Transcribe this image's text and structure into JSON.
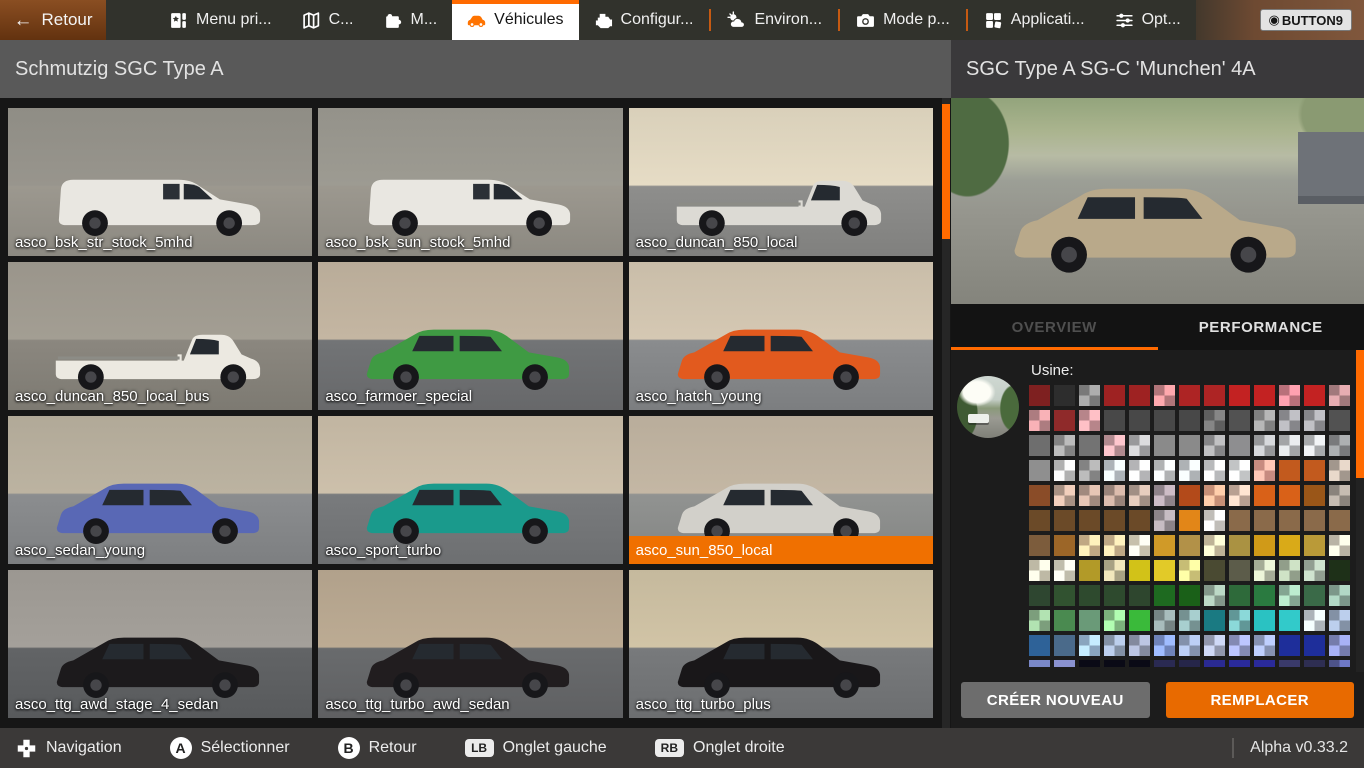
{
  "top_bar": {
    "back_label": "Retour",
    "tabs": [
      {
        "label": "Menu pri...",
        "icon": "main-menu-icon",
        "active": false,
        "sep_before": false
      },
      {
        "label": "C...",
        "icon": "map-icon",
        "active": false,
        "sep_before": false
      },
      {
        "label": "M...",
        "icon": "mods-icon",
        "active": false,
        "sep_before": false
      },
      {
        "label": "Véhicules",
        "icon": "vehicles-icon",
        "active": true,
        "sep_before": false
      },
      {
        "label": "Configur...",
        "icon": "engine-icon",
        "active": false,
        "sep_before": false
      },
      {
        "label": "Environ...",
        "icon": "environment-icon",
        "active": false,
        "sep_before": true
      },
      {
        "label": "Mode p...",
        "icon": "camera-icon",
        "active": false,
        "sep_before": true
      },
      {
        "label": "Applicati...",
        "icon": "apps-icon",
        "active": false,
        "sep_before": true
      },
      {
        "label": "Opt...",
        "icon": "sliders-icon",
        "active": false,
        "sep_before": false
      }
    ],
    "button9_label": "BUTTON9"
  },
  "left_panel": {
    "title": "Schmutzig SGC Type A",
    "vehicles": [
      {
        "name": "asco_bsk_str_stock_5mhd",
        "selected": false,
        "body": "van",
        "paint": "#e9e7e1",
        "bg_top": "#8f8d85",
        "bg_bottom": "#9c988f"
      },
      {
        "name": "asco_bsk_sun_stock_5mhd",
        "selected": false,
        "body": "van",
        "paint": "#e9e7e1",
        "bg_top": "#94928a",
        "bg_bottom": "#9c988f"
      },
      {
        "name": "asco_duncan_850_local",
        "selected": false,
        "body": "flatbed",
        "paint": "#dcdad4",
        "bg_top": "#d9d0ba",
        "bg_bottom": "#8e8e8c"
      },
      {
        "name": "asco_duncan_850_local_bus",
        "selected": false,
        "body": "flatbed",
        "paint": "#ece9e1",
        "bg_top": "#9a958b",
        "bg_bottom": "#8b877f"
      },
      {
        "name": "asco_farmoer_special",
        "selected": false,
        "body": "hatch",
        "paint": "#3f9a43",
        "bg_top": "#b9ac99",
        "bg_bottom": "#727476"
      },
      {
        "name": "asco_hatch_young",
        "selected": false,
        "body": "hatch",
        "paint": "#e25a1e",
        "bg_top": "#c9bda9",
        "bg_bottom": "#8a8c8e"
      },
      {
        "name": "asco_sedan_young",
        "selected": false,
        "body": "hatch",
        "paint": "#5968b5",
        "bg_top": "#b1a998",
        "bg_bottom": "#8b8d8f"
      },
      {
        "name": "asco_sport_turbo",
        "selected": false,
        "body": "hatch",
        "paint": "#1a9a8c",
        "bg_top": "#c1b5a1",
        "bg_bottom": "#797b7d"
      },
      {
        "name": "asco_sun_850_local",
        "selected": true,
        "body": "hatch",
        "paint": "#d2d0ca",
        "bg_top": "#b9ad9b",
        "bg_bottom": "#919391"
      },
      {
        "name": "asco_ttg_awd_stage_4_sedan",
        "selected": false,
        "body": "hatch",
        "paint": "#1c1a1c",
        "bg_top": "#9b9791",
        "bg_bottom": "#626466"
      },
      {
        "name": "asco_ttg_turbo_awd_sedan",
        "selected": false,
        "body": "hatch",
        "paint": "#211d1f",
        "bg_top": "#b1a18b",
        "bg_bottom": "#696b6d"
      },
      {
        "name": "asco_ttg_turbo_plus",
        "selected": false,
        "body": "hatch",
        "paint": "#191719",
        "bg_top": "#c5b99d",
        "bg_bottom": "#787a7c"
      }
    ]
  },
  "right_panel": {
    "title": "SGC Type A SG-C 'Munchen' 4A",
    "preview_paint": "#b9a98a",
    "tabs": [
      {
        "label": "OVERVIEW",
        "active": true
      },
      {
        "label": "PERFORMANCE",
        "active": false
      }
    ],
    "paint_section_label": "Usine:",
    "palette_rows": [
      [
        "#7e2020",
        "#2d2d2d",
        "#8e8e8e*",
        "#9e2222",
        "#9e2222",
        "#d08a8e*",
        "#ad2424",
        "#ad2424",
        "#c32222",
        "#c32222",
        "#da8490*",
        "#c32222",
        "#bd8e92*"
      ],
      [
        "#cc9296*",
        "#8f2a2a",
        "#d79da2*",
        "#484848",
        "#484848",
        "#484848",
        "#484848",
        "#6e6e6e*",
        "#525252",
        "#969696*",
        "#9e9ea2*",
        "#9e9ea2*",
        "#525252"
      ],
      [
        "#6e6e6e",
        "#9a9a9a*",
        "#737373",
        "#d0a2a8*",
        "#b4b4b6*",
        "#8a8a8a",
        "#8a8a8a",
        "#9e9ea0*",
        "#8e8e90",
        "#b0b2b4*",
        "#c0c2c4*",
        "#c6c8ca*",
        "#8e9092*"
      ],
      [
        "#8f8f8f",
        "#cfcfcf*",
        "#9a9a9a*",
        "#ccd2d8*",
        "#d4d4d6*",
        "#cfd1d3*",
        "#cdd1d5*",
        "#d8dadc*",
        "#e4e6e8*",
        "#eaa496*",
        "#c25a1e",
        "#c25a1e",
        "#bfb2a6*"
      ],
      [
        "#8a4c28",
        "#c6aa9a*",
        "#bda294*",
        "#b49a8e*",
        "#bda89c*",
        "#a89aa2*",
        "#b34a1a",
        "#eaa98c*",
        "#d9bcac*",
        "#d96118",
        "#d96118",
        "#9a5618",
        "#a29a92*"
      ],
      [
        "#6b4a28",
        "#6b4a28",
        "#6b4a28",
        "#6b4a28",
        "#6b4a28",
        "#a39aa0*",
        "#e28618",
        "#e2ded8*",
        "#8a6a4a",
        "#8a6a4a",
        "#8a6a4a",
        "#8a6a4a",
        "#8a6a4a"
      ],
      [
        "#7c5c3c",
        "#9c6628",
        "#e2c69a*",
        "#dfc69c*",
        "#eae2ca*",
        "#d09a28",
        "#b29148",
        "#dfd2b2*",
        "#aa9242",
        "#d09a18",
        "#d9aa18",
        "#ba9a38",
        "#dad2c2*"
      ],
      [
        "#dfdac2*",
        "#e2deca*",
        "#b29a28",
        "#c6be9a*",
        "#d2c218",
        "#e2ca28",
        "#eade8a*",
        "#4a4a32",
        "#5c5c4a",
        "#c2cab2*",
        "#aabaa2*",
        "#aabaaa*",
        "#1e3018"
      ],
      [
        "#2e4630",
        "#315230",
        "#2e4a2e",
        "#2e4a2e",
        "#2e462e",
        "#1e6a20",
        "#1a6018",
        "#9ab2a2*",
        "#2e6a3a",
        "#2a7a40",
        "#9ac2aa*",
        "#3a6a48",
        "#92b2a2*"
      ],
      [
        "#92ba92*",
        "#4a8a50",
        "#6a9a78",
        "#92d092*",
        "#3aba3a",
        "#8a9a9a*",
        "#8aaaaa*",
        "#1a7a82",
        "#72b2b2*",
        "#2ac2c2",
        "#32caca",
        "#cad2da*",
        "#9aaac2*"
      ],
      [
        "#2e6298",
        "#4a6a8a",
        "#a2c2df*",
        "#9aaac2*",
        "#9aa2ba*",
        "#829ada*",
        "#9aaaca*",
        "#aab2ca*",
        "#9aa2d2*",
        "#9caad0*",
        "#1e2e9a",
        "#1e2e9a",
        "#8a92ca*"
      ],
      [
        "#7a88c8",
        "#8a92d0",
        "#0a0a16",
        "#0a0a16",
        "#0a0a16",
        "#2a2a52",
        "#26264a",
        "#2a2a92",
        "#2a2a9a",
        "#2a2a9a",
        "#3a3a6a",
        "#2e2e52",
        "#5a62a2*"
      ]
    ],
    "create_label": "CRÉER NOUVEAU",
    "replace_label": "REMPLACER"
  },
  "bottom_bar": {
    "hints": [
      {
        "icon": "dpad-icon",
        "kind": "dpad",
        "glyph": "",
        "label": "Navigation"
      },
      {
        "icon": "a-button-icon",
        "kind": "circle",
        "glyph": "A",
        "label": "Sélectionner"
      },
      {
        "icon": "b-button-icon",
        "kind": "circle",
        "glyph": "B",
        "label": "Retour"
      },
      {
        "icon": "lb-button-icon",
        "kind": "pill",
        "glyph": "LB",
        "label": "Onglet gauche"
      },
      {
        "icon": "rb-button-icon",
        "kind": "pill",
        "glyph": "RB",
        "label": "Onglet droite"
      }
    ],
    "version": "Alpha v0.33.2"
  },
  "colors": {
    "accent_orange": "#ff6a00",
    "selected_label_bg": "#f07000",
    "back_button_brown": "#7c4419",
    "active_tab_bg": "#ffffff",
    "replace_button_bg": "#e86a00",
    "create_button_bg": "#6d6d6d"
  }
}
